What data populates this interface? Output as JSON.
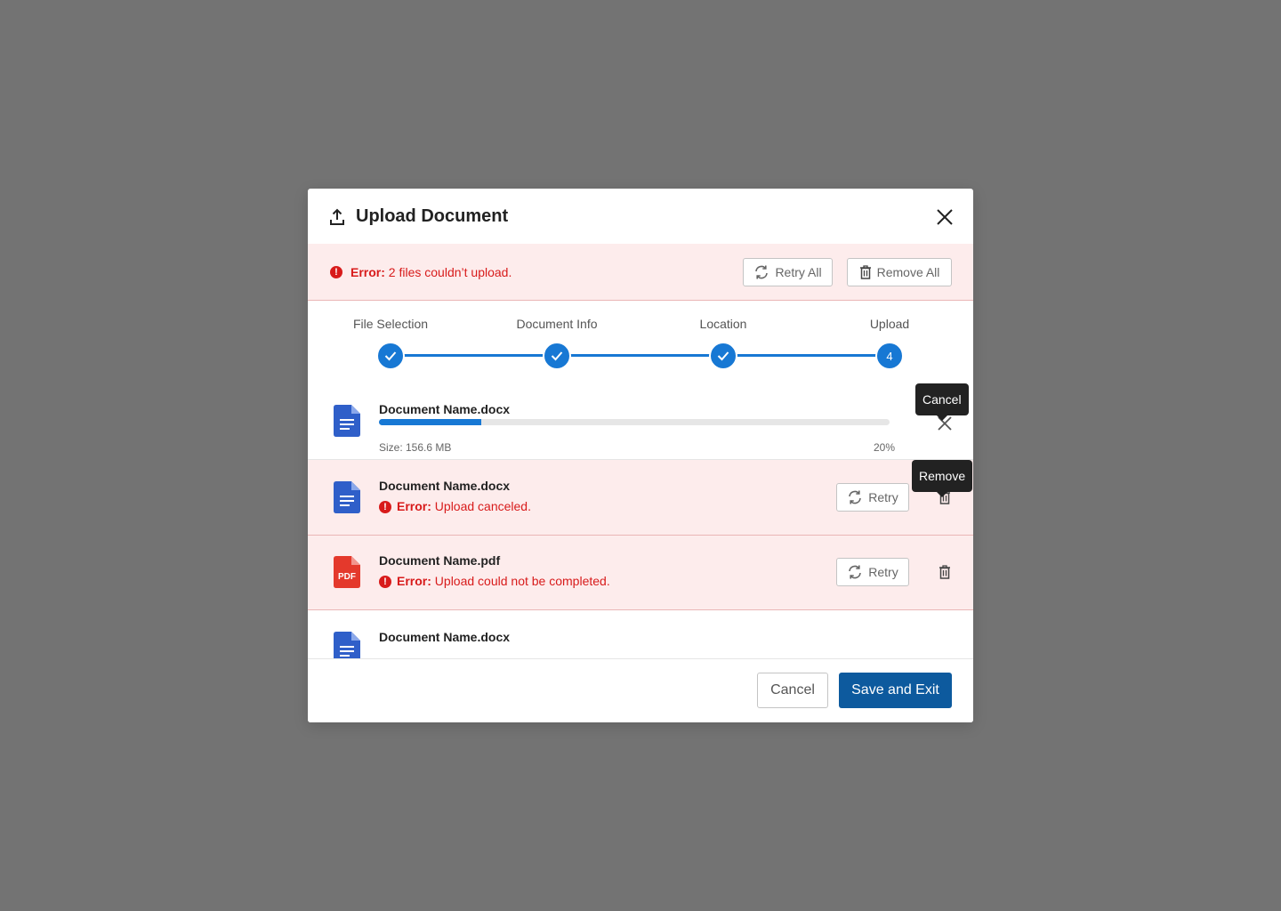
{
  "dialog": {
    "title": "Upload Document"
  },
  "banner": {
    "error_prefix": "Error:",
    "error_text": " 2 files couldn’t upload.",
    "retry_all_label": "Retry All",
    "remove_all_label": "Remove All"
  },
  "stepper": {
    "steps": [
      {
        "label": "File Selection",
        "state": "complete"
      },
      {
        "label": "Document Info",
        "state": "complete"
      },
      {
        "label": "Location",
        "state": "complete"
      },
      {
        "label": "Upload",
        "state": "current",
        "number": "4"
      }
    ]
  },
  "files": [
    {
      "name": "Document Name.docx",
      "type": "docx",
      "status": "uploading",
      "progress_percent": 20,
      "progress_label": "20%",
      "size_label": "Size: 156.6 MB",
      "action_tooltip": "Cancel"
    },
    {
      "name": "Document Name.docx",
      "type": "docx",
      "status": "error",
      "error_prefix": "Error:",
      "error_text": " Upload canceled.",
      "retry_label": "Retry",
      "action_tooltip": "Remove"
    },
    {
      "name": "Document Name.pdf",
      "type": "pdf",
      "icon_text": "PDF",
      "status": "error",
      "error_prefix": "Error:",
      "error_text": " Upload could not be completed.",
      "retry_label": "Retry"
    },
    {
      "name": "Document Name.docx",
      "type": "docx",
      "status": "queued"
    }
  ],
  "footer": {
    "cancel_label": "Cancel",
    "save_label": "Save and Exit"
  },
  "colors": {
    "accent": "#1778d4",
    "primary_button": "#0d5a9e",
    "error": "#d81b1b",
    "error_background": "#fdecec",
    "overlay": "#737373",
    "docx_icon": "#2f5fc9",
    "pdf_icon": "#e4392c"
  }
}
